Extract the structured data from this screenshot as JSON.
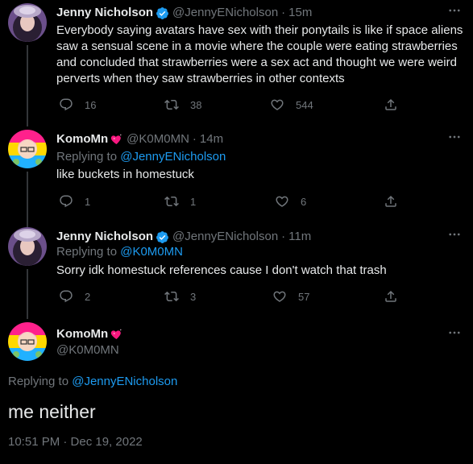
{
  "tweets": [
    {
      "name": "Jenny Nicholson",
      "handle": "@JennyENicholson",
      "sep": "·",
      "time": "15m",
      "text_lines": [
        "Everybody saying avatars have sex with their ponytails is like if space aliens",
        "saw a sensual scene in a movie where the couple were eating strawberries",
        "and concluded that strawberries were a sex act and thought we were weird",
        "perverts when they saw strawberries in other contexts"
      ],
      "replies": "16",
      "retweets": "38",
      "likes": "544"
    },
    {
      "name": "KomoMn",
      "handle": "@K0M0MN",
      "sep": "·",
      "time": "14m",
      "replying_prefix": "Replying to",
      "replying_to": "@JennyENicholson",
      "text": "like buckets in homestuck",
      "replies": "1",
      "retweets": "1",
      "likes": "6"
    },
    {
      "name": "Jenny Nicholson",
      "handle": "@JennyENicholson",
      "sep": "·",
      "time": "11m",
      "replying_prefix": "Replying to",
      "replying_to": "@K0M0MN",
      "text": "Sorry idk homestuck references cause I don't watch that trash",
      "replies": "2",
      "retweets": "3",
      "likes": "57"
    }
  ],
  "main_tweet": {
    "name": "KomoMn",
    "handle": "@K0M0MN",
    "replying_prefix": "Replying to",
    "replying_to": "@JennyENicholson",
    "text": "me neither",
    "timestamp": "10:51 PM · Dec 19, 2022"
  },
  "colors": {
    "background": "#000000",
    "text": "#e7e9ea",
    "muted": "#71767b",
    "accent": "#1d9bf0",
    "badge_heart": "#f91880"
  }
}
